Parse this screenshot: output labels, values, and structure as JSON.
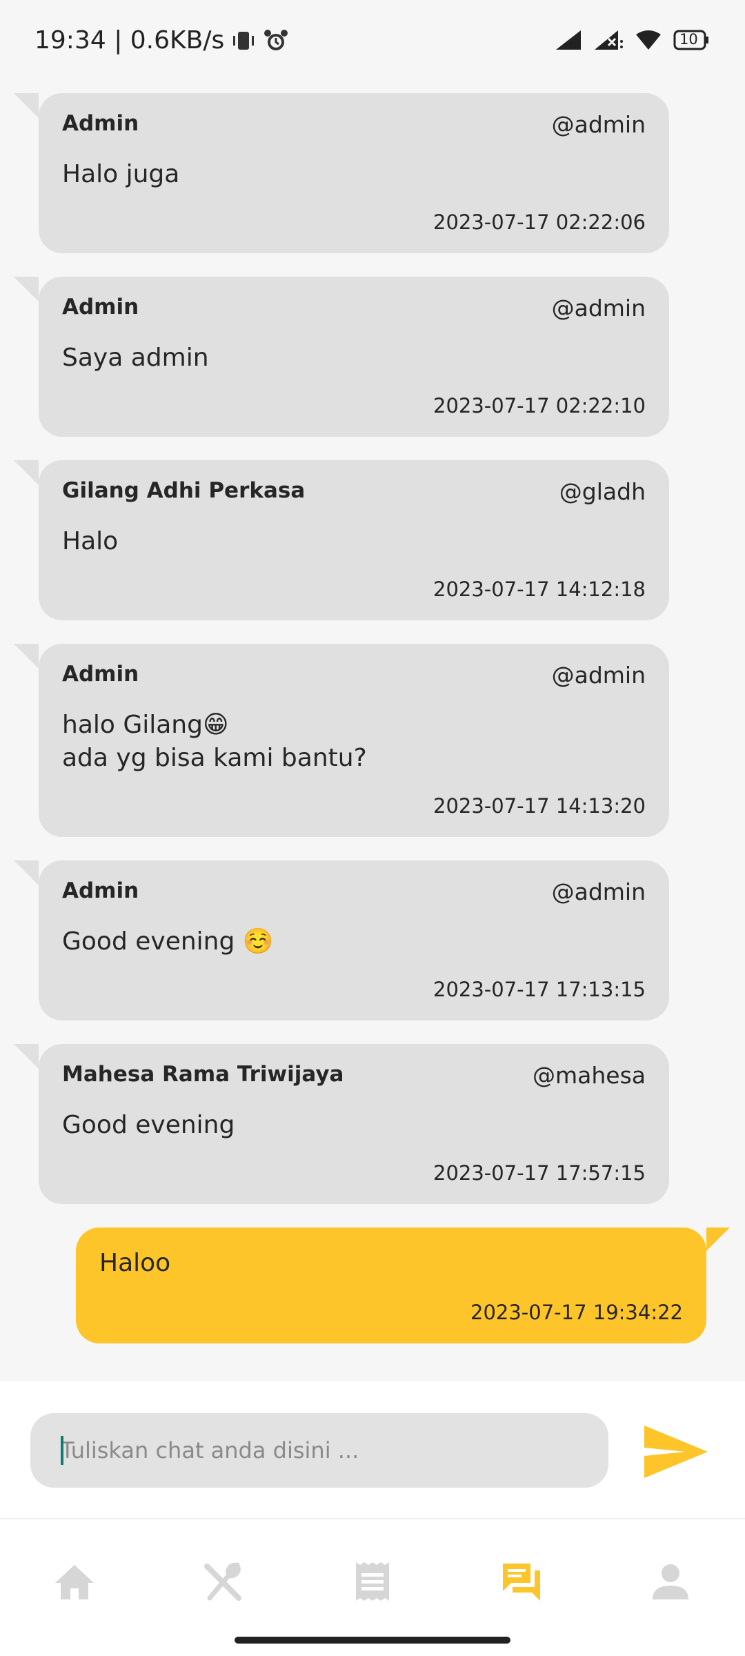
{
  "status_bar": {
    "time_speed": "19:34 | 0.6KB/s",
    "battery": "10",
    "icons": [
      "vibrate-icon",
      "alarm-icon",
      "signal-icon",
      "signal-no-service-icon",
      "wifi-icon",
      "battery-icon"
    ]
  },
  "messages": [
    {
      "sender": "Admin",
      "handle": "@admin",
      "text": "Halo juga",
      "time": "2023-07-17 02:22:06"
    },
    {
      "sender": "Admin",
      "handle": "@admin",
      "text": "Saya admin",
      "time": "2023-07-17 02:22:10"
    },
    {
      "sender": "Gilang Adhi Perkasa",
      "handle": "@gladh",
      "text": "Halo",
      "time": "2023-07-17 14:12:18"
    },
    {
      "sender": "Admin",
      "handle": "@admin",
      "text": "halo Gilang😁\nada yg bisa kami bantu?",
      "time": "2023-07-17 14:13:20"
    },
    {
      "sender": "Admin",
      "handle": "@admin",
      "text": "Good evening ☺️",
      "time": "2023-07-17 17:13:15"
    },
    {
      "sender": "Mahesa Rama Triwijaya",
      "handle": "@mahesa",
      "text": "Good evening",
      "time": "2023-07-17 17:57:15"
    }
  ],
  "outgoing": {
    "text": "Haloo",
    "time": "2023-07-17 19:34:22"
  },
  "composer": {
    "placeholder": "Tuliskan chat anda disini ...",
    "value": ""
  },
  "nav": {
    "items": [
      "home-icon",
      "food-icon",
      "receipt-icon",
      "chat-icon",
      "profile-icon"
    ],
    "active": "chat-icon"
  },
  "colors": {
    "accent": "#fdc52a",
    "bubble": "#e0e0e0",
    "inactive_icon": "#d6d6d6",
    "cursor": "#0b7f6e"
  }
}
